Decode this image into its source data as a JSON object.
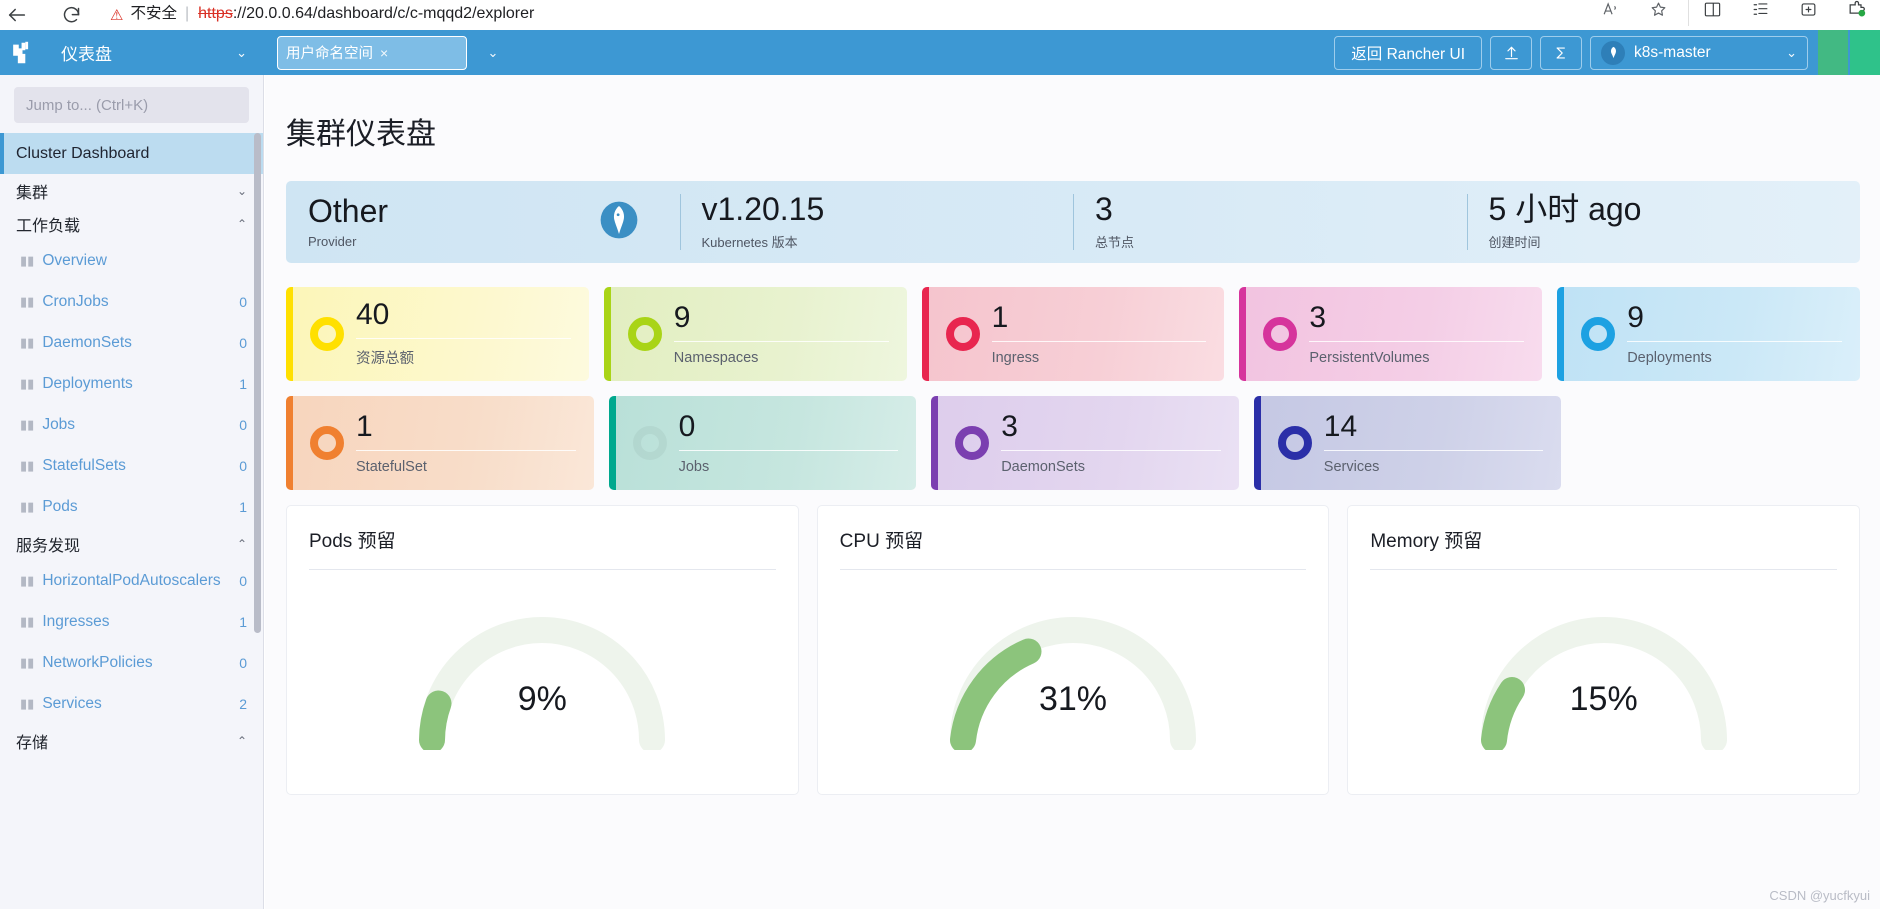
{
  "browser": {
    "back_icon": "back-arrow-icon",
    "reload_icon": "reload-icon",
    "security_warning": "不安全",
    "url_scheme": "https",
    "url_rest": "://20.0.0.64/dashboard/c/c-mqqd2/explorer",
    "url_host": "20.0.0.64",
    "url_path": "/dashboard/c/c-mqqd2/explorer",
    "actions": [
      "read-aloud-icon",
      "favorite-icon",
      "split-screen-icon",
      "collections-icon",
      "browser-essentials-icon",
      "extensions-icon"
    ]
  },
  "header": {
    "logo": "rancher-logo",
    "nav_label": "仪表盘",
    "namespace_filter": {
      "tag": "用户命名空间",
      "remove": "×"
    },
    "back_to_rancher": "返回 Rancher UI",
    "import_yaml_icon": "upload-icon",
    "shell_icon": "kubectl-shell-icon",
    "cluster_name": "k8s-master",
    "cluster_icon": "cluster-icon",
    "chevron": "⌄"
  },
  "sidebar": {
    "search_placeholder": "Jump to... (Ctrl+K)",
    "active_item": "Cluster Dashboard",
    "groups": [
      {
        "label": "集群",
        "chevron": "⌄",
        "items": []
      },
      {
        "label": "工作负载",
        "chevron": "⌃",
        "items": [
          {
            "label": "Overview",
            "count": ""
          },
          {
            "label": "CronJobs",
            "count": "0"
          },
          {
            "label": "DaemonSets",
            "count": "0"
          },
          {
            "label": "Deployments",
            "count": "1"
          },
          {
            "label": "Jobs",
            "count": "0"
          },
          {
            "label": "StatefulSets",
            "count": "0"
          },
          {
            "label": "Pods",
            "count": "1"
          }
        ]
      },
      {
        "label": "服务发现",
        "chevron": "⌃",
        "items": [
          {
            "label": "HorizontalPodAutoscalers",
            "count": "0"
          },
          {
            "label": "Ingresses",
            "count": "1"
          },
          {
            "label": "NetworkPolicies",
            "count": "0"
          },
          {
            "label": "Services",
            "count": "2"
          }
        ]
      },
      {
        "label": "存储",
        "chevron": "⌃",
        "items": []
      }
    ]
  },
  "main": {
    "page_title": "集群仪表盘",
    "summary": [
      {
        "value": "Other",
        "label": "Provider",
        "logo": "kubernetes-logo"
      },
      {
        "value": "v1.20.15",
        "label": "Kubernetes 版本"
      },
      {
        "value": "3",
        "label": "总节点"
      },
      {
        "value": "5 小时 ago",
        "label": "创建时间"
      }
    ],
    "counters_row1": [
      {
        "value": "40",
        "label": "资源总额",
        "color": "#FFE000",
        "zero": false
      },
      {
        "value": "9",
        "label": "Namespaces",
        "color": "#A9D417",
        "zero": false
      },
      {
        "value": "1",
        "label": "Ingress",
        "color": "#E8264F",
        "zero": false
      },
      {
        "value": "3",
        "label": "PersistentVolumes",
        "color": "#D6349C",
        "zero": false
      },
      {
        "value": "9",
        "label": "Deployments",
        "color": "#1DA1E2",
        "zero": false
      }
    ],
    "counters_row2": [
      {
        "value": "1",
        "label": "StatefulSet",
        "color": "#F08030",
        "zero": false
      },
      {
        "value": "0",
        "label": "Jobs",
        "color": "#00A88E",
        "zero": true
      },
      {
        "value": "3",
        "label": "DaemonSets",
        "color": "#7B3FB0",
        "zero": false
      },
      {
        "value": "14",
        "label": "Services",
        "color": "#2B2FA8",
        "zero": false
      }
    ],
    "gauges": [
      {
        "title": "Pods 预留",
        "percent": "9%",
        "value": 9
      },
      {
        "title": "CPU 预留",
        "percent": "31%",
        "value": 31
      },
      {
        "title": "Memory 预留",
        "percent": "15%",
        "value": 15
      }
    ]
  },
  "watermark": "CSDN @yucfkyui",
  "chart_data": [
    {
      "type": "gauge",
      "title": "Pods 预留",
      "value": 9,
      "unit": "%",
      "min": 0,
      "max": 100,
      "arc_color": "#8cc47c",
      "track_color": "#eef4ec"
    },
    {
      "type": "gauge",
      "title": "CPU 预留",
      "value": 31,
      "unit": "%",
      "min": 0,
      "max": 100,
      "arc_color": "#8cc47c",
      "track_color": "#eef4ec"
    },
    {
      "type": "gauge",
      "title": "Memory 预留",
      "value": 15,
      "unit": "%",
      "min": 0,
      "max": 100,
      "arc_color": "#8cc47c",
      "track_color": "#eef4ec"
    }
  ]
}
